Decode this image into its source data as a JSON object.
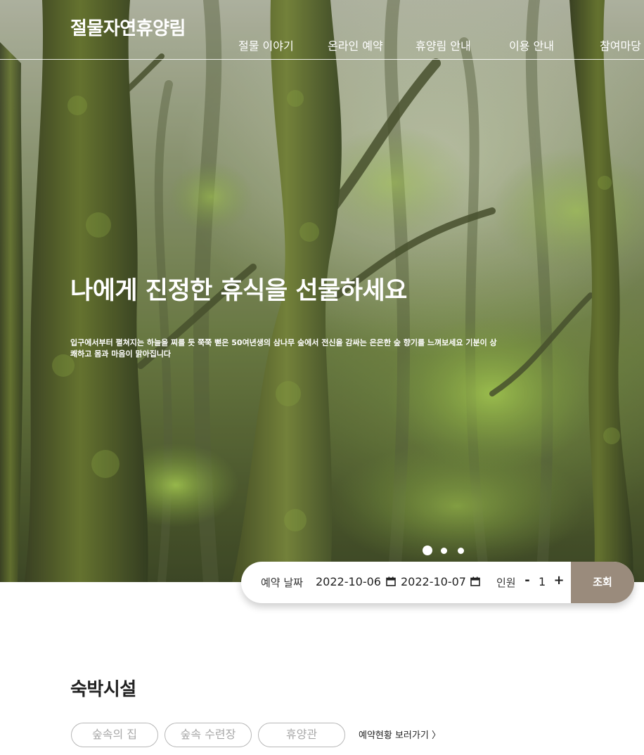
{
  "header": {
    "site_title": "절물자연휴양림",
    "nav": [
      "절물 이야기",
      "온라인 예약",
      "휴양림 안내",
      "이용 안내",
      "참여마당"
    ]
  },
  "hero": {
    "headline": "나에게 진정한 휴식을 선물하세요",
    "description": "입구에서부터 펼쳐지는 하늘을 찌를 듯 쭉쭉 뻗은 50여년생의 삼나무 숲에서 전신을 감싸는 은은한 숲 향기를 느껴보세요 기분이 상쾌하고 몸과 마음이 맑아집니다",
    "slide_count": 3,
    "active_slide": 1
  },
  "booking": {
    "date_label": "예약 날짜",
    "check_in": "2022-10-06",
    "check_out": "2022-10-07",
    "people_label": "인원",
    "decrement": "-",
    "people_count": "1",
    "increment": "+",
    "search_label": "조회",
    "search_color": "#9a8b7c"
  },
  "lodging": {
    "title": "숙박시설",
    "tabs": [
      "숲속의 집",
      "숲속 수련장",
      "휴양관"
    ],
    "status_link": "예약현황 보러가기 〉"
  },
  "icons": {
    "calendar": "calendar-icon"
  }
}
